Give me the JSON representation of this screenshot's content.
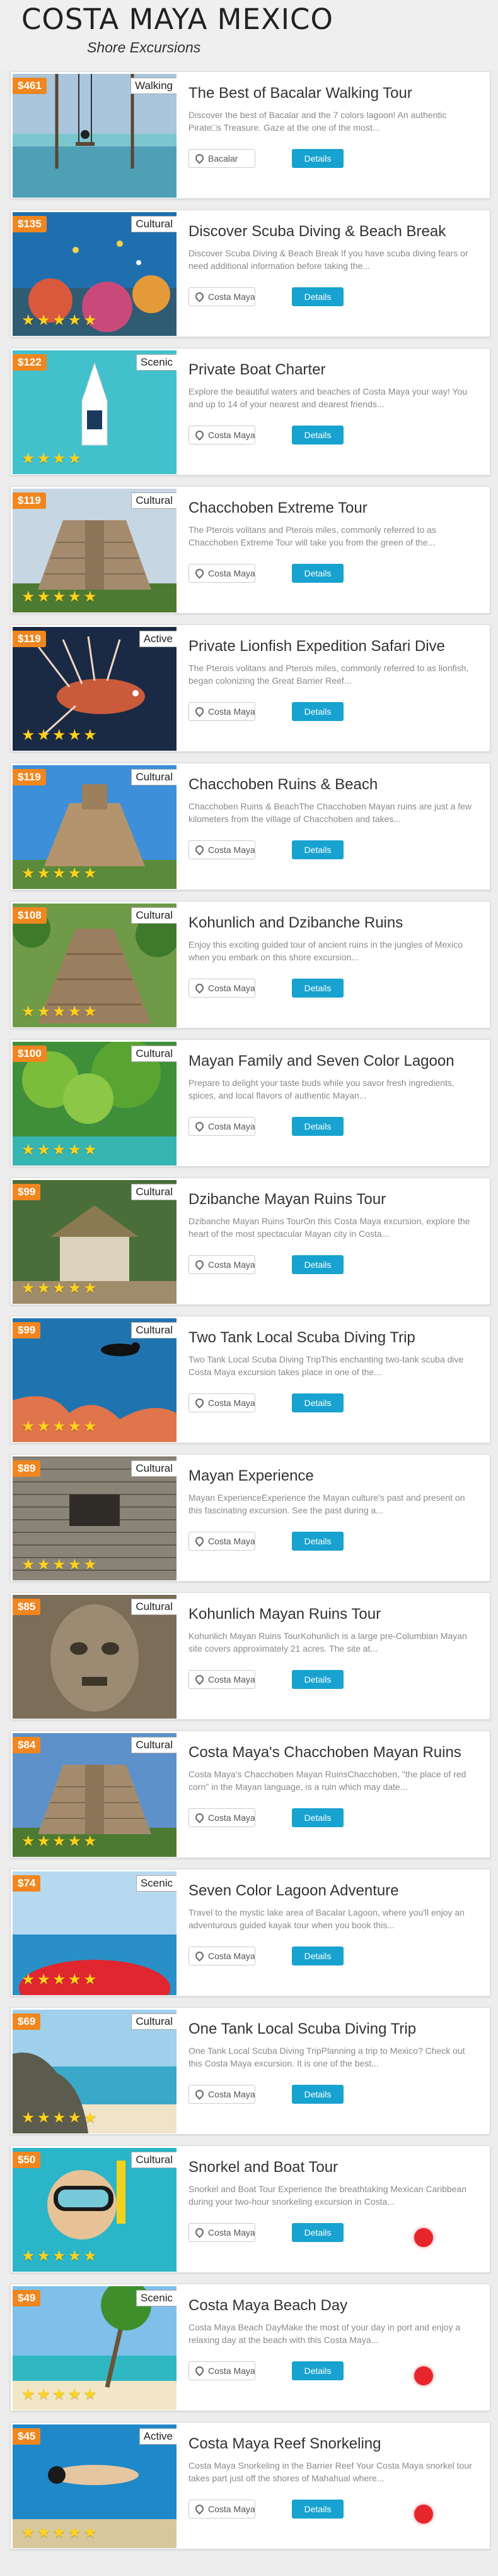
{
  "header": {
    "title": "COSTA MAYA MEXICO",
    "subtitle": "Shore Excursions"
  },
  "location_label": "Costa Maya...",
  "details_label": "Details",
  "cards": [
    {
      "price": "$461",
      "category": "Walking",
      "title": "The Best of Bacalar Walking Tour",
      "desc": "Discover the best of Bacalar and the 7 colors lagoon! An authentic Pirate□s Treasure. Gaze at the one of the most...",
      "location": "Bacalar",
      "stars": 0,
      "scene": "swing"
    },
    {
      "price": "$135",
      "category": "Cultural",
      "title": "Discover Scuba Diving & Beach Break",
      "desc": "Discover Scuba Diving & Beach Break If you have scuba diving fears or need additional information before taking the...",
      "location": "Costa Maya...",
      "stars": 5,
      "scene": "reef"
    },
    {
      "price": "$122",
      "category": "Scenic",
      "title": "Private Boat Charter",
      "desc": "Explore the beautiful waters and beaches of Costa Maya your way! You and up to 14 of your nearest and dearest friends...",
      "location": "Costa Maya...",
      "stars": 4,
      "scene": "boat"
    },
    {
      "price": "$119",
      "category": "Cultural",
      "title": "Chacchoben Extreme Tour",
      "desc": "The Pterois volitans and Pterois miles, commonly referred to as Chacchoben Extreme Tour will take you from the green of the...",
      "location": "Costa Maya...",
      "stars": 5,
      "scene": "pyramid"
    },
    {
      "price": "$119",
      "category": "Active",
      "title": "Private Lionfish Expedition Safari Dive",
      "desc": "The Pterois volitans and Pterois miles, commonly referred to as lionfish, began colonizing the Great Barrier Reef...",
      "location": "Costa Maya...",
      "stars": 5,
      "scene": "lionfish"
    },
    {
      "price": "$119",
      "category": "Cultural",
      "title": "Chacchoben Ruins & Beach",
      "desc": "Chacchoben Ruins & BeachThe Chacchoben Mayan ruins are just a few kilometers from the village of Chacchoben and takes...",
      "location": "Costa Maya...",
      "stars": 5,
      "scene": "ruins"
    },
    {
      "price": "$108",
      "category": "Cultural",
      "title": "Kohunlich and Dzibanche Ruins",
      "desc": "Enjoy this exciting guided tour of ancient ruins in the jungles of Mexico when you embark on this shore excursion...",
      "location": "Costa Maya...",
      "stars": 5,
      "scene": "jungle-ruins"
    },
    {
      "price": "$100",
      "category": "Cultural",
      "title": "Mayan Family and Seven Color Lagoon",
      "desc": "Prepare to delight your taste buds while you savor fresh ingredients, spices, and local flavors of authentic Mayan...",
      "location": "Costa Maya...",
      "stars": 5,
      "scene": "palms"
    },
    {
      "price": "$99",
      "category": "Cultural",
      "title": "Dzibanche Mayan Ruins Tour",
      "desc": "Dzibanche Mayan Ruins TourOn this Costa Maya excursion, explore the heart of the most spectacular Mayan city in Costa...",
      "location": "Costa Maya...",
      "stars": 5,
      "scene": "hut"
    },
    {
      "price": "$99",
      "category": "Cultural",
      "title": "Two Tank Local Scuba Diving Trip",
      "desc": "Two Tank Local Scuba Diving TripThis enchanting two-tank scuba dive Costa Maya excursion takes place in one of the...",
      "location": "Costa Maya...",
      "stars": 5,
      "scene": "diver"
    },
    {
      "price": "$89",
      "category": "Cultural",
      "title": "Mayan Experience",
      "desc": "Mayan ExperienceExperience the Mayan culture's past and present on this fascinating excursion. See the past during a...",
      "location": "Costa Maya...",
      "stars": 5,
      "scene": "stonewall"
    },
    {
      "price": "$85",
      "category": "Cultural",
      "title": "Kohunlich Mayan Ruins Tour",
      "desc": "Kohunlich Mayan Ruins TourKohunlich is a large pre-Columbian Mayan site covers approximately 21 acres. The site at...",
      "location": "Costa Maya...",
      "stars": 0,
      "scene": "mask"
    },
    {
      "price": "$84",
      "category": "Cultural",
      "title": "Costa Maya's Chacchoben Mayan Ruins",
      "desc": "Costa Maya's Chacchoben Mayan RuinsChacchoben, \"the place of red corn\" in the Mayan language, is a ruin which may date...",
      "location": "Costa Maya...",
      "stars": 5,
      "scene": "pyramid2"
    },
    {
      "price": "$74",
      "category": "Scenic",
      "title": "Seven Color Lagoon Adventure",
      "desc": "Travel to the mystic lake area of Bacalar Lagoon, where you'll enjoy an adventurous guided kayak tour when you book this...",
      "location": "Costa Maya...",
      "stars": 5,
      "scene": "kayak"
    },
    {
      "price": "$69",
      "category": "Cultural",
      "title": "One Tank Local Scuba Diving Trip",
      "desc": "One Tank Local Scuba Diving TripPlanning a trip to Mexico? Check out this Costa Maya excursion. It is one of the best...",
      "location": "Costa Maya...",
      "stars": 5,
      "scene": "beach-rocks"
    },
    {
      "price": "$50",
      "category": "Cultural",
      "title": "Snorkel and Boat Tour",
      "desc": "Snorkel and Boat Tour Experience the breathtaking Mexican Caribbean during your two-hour snorkeling excursion in Costa...",
      "location": "Costa Maya...",
      "stars": 5,
      "scene": "snorkel",
      "dot": true
    },
    {
      "price": "$49",
      "category": "Scenic",
      "title": "Costa Maya Beach Day",
      "desc": "Costa Maya Beach DayMake the most of your day in port and enjoy a relaxing day at the beach with this Costa Maya...",
      "location": "Costa Maya...",
      "stars": 5,
      "scene": "beach-palm",
      "dot": true
    },
    {
      "price": "$45",
      "category": "Active",
      "title": "Costa Maya Reef Snorkeling",
      "desc": "Costa Maya Snorkeling in the Barrier Reef Your Costa Maya snorkel tour takes part just off the shores of Mahahual where...",
      "location": "Costa Maya...",
      "stars": 5,
      "scene": "snorkel2",
      "dot": true
    }
  ]
}
